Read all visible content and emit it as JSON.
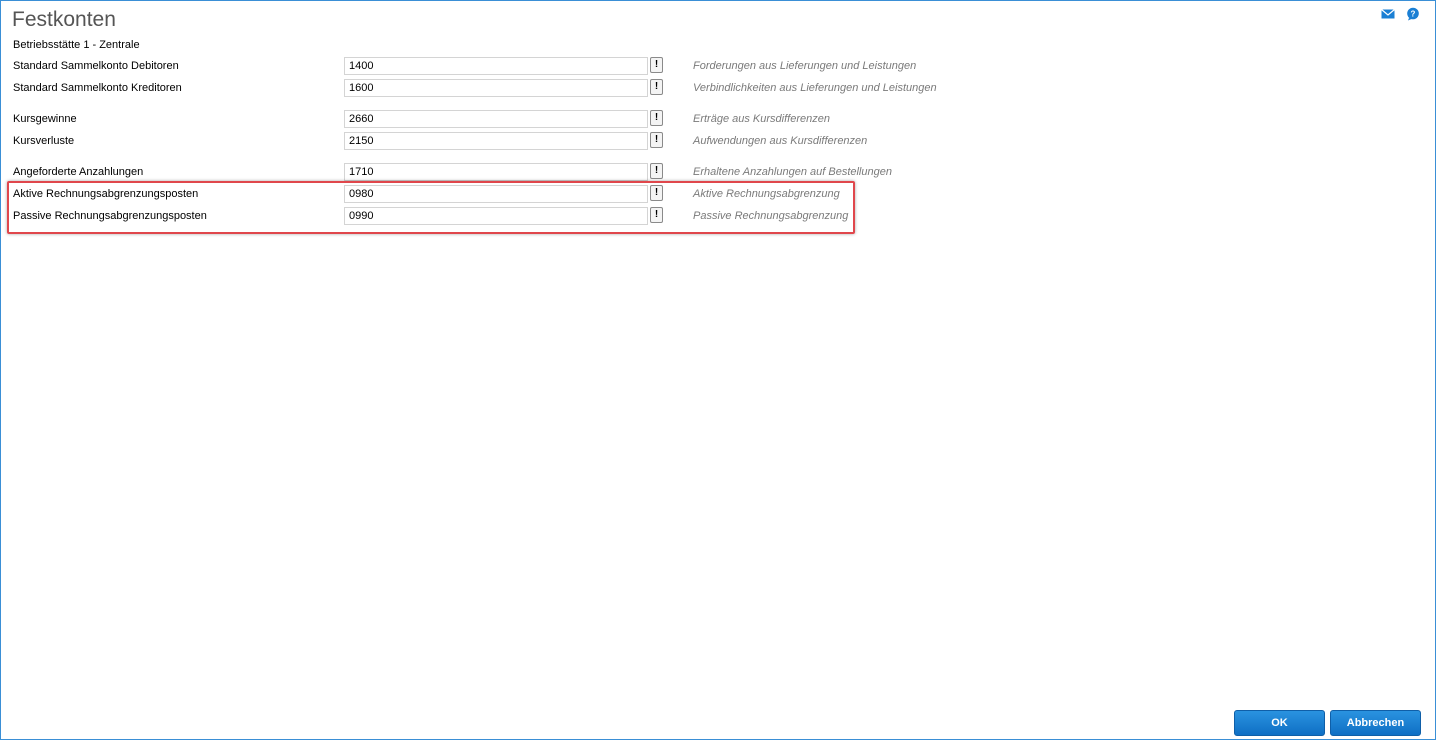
{
  "window": {
    "title": "Festkonten",
    "subtitle": "Betriebsstätte 1 - Zentrale",
    "icons": [
      "mail-icon",
      "help-icon"
    ],
    "accent_color": "#3a8fd6"
  },
  "rows": [
    {
      "label": "Standard Sammelkonto Debitoren",
      "value": "1400",
      "description": "Forderungen aus Lieferungen und Leistungen"
    },
    {
      "label": "Standard Sammelkonto Kreditoren",
      "value": "1600",
      "description": "Verbindlichkeiten aus Lieferungen und Leistungen"
    },
    {
      "label": "Kursgewinne",
      "value": "2660",
      "description": "Erträge aus Kursdifferenzen"
    },
    {
      "label": "Kursverluste",
      "value": "2150",
      "description": "Aufwendungen aus Kursdifferenzen"
    },
    {
      "label": "Angeforderte Anzahlungen",
      "value": "1710",
      "description": "Erhaltene Anzahlungen auf Bestellungen"
    },
    {
      "label": "Aktive Rechnungsabgrenzungsposten",
      "value": "0980",
      "description": "Aktive Rechnungsabgrenzung"
    },
    {
      "label": "Passive Rechnungsabgrenzungsposten",
      "value": "0990",
      "description": "Passive Rechnungsabgrenzung"
    }
  ],
  "lookup_button_label": "!",
  "highlight_color": "#e0474c",
  "buttons": {
    "ok": "OK",
    "cancel": "Abbrechen",
    "color": "#1a7fd4"
  }
}
